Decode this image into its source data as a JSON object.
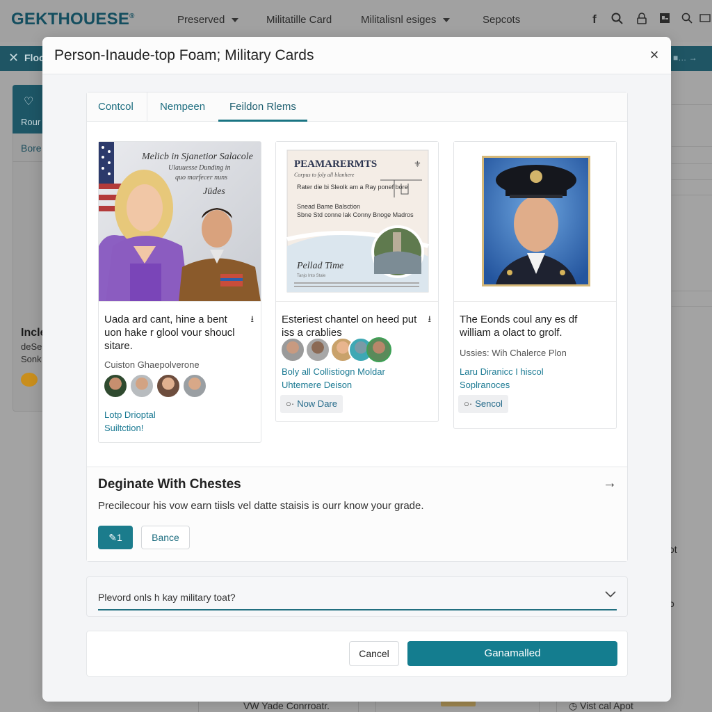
{
  "background": {
    "logo": "GEKTHOUESE",
    "nav": [
      {
        "label": "Preserved",
        "has_dropdown": true
      },
      {
        "label": "Militatille Card",
        "has_dropdown": false
      },
      {
        "label": "Militalisnl esiges",
        "has_dropdown": true
      },
      {
        "label": "Sepcots",
        "has_dropdown": false
      }
    ],
    "header_icons": [
      "facebook-icon",
      "search-icon",
      "lock-icon",
      "image-icon",
      "search-icon",
      "window-icon"
    ],
    "teal_bar_label": "Floo",
    "sidebar": {
      "top_label": "Rour",
      "item": "Bore",
      "heading": "Incle",
      "line1": "deSe",
      "line2": "Sonk"
    },
    "right_text_1": "ot",
    "right_text_2": "o",
    "bottom_items": [
      "VW Yade Conrroatr.",
      "Vist cal Apot"
    ]
  },
  "modal": {
    "title": "Person-Inaude-top Foam; Military Cards",
    "close_label": "×",
    "tabs": [
      {
        "label": "Contcol",
        "active": false
      },
      {
        "label": "Nempeen",
        "active": false
      },
      {
        "label": "Feildon Rlems",
        "active": true
      }
    ],
    "cards": [
      {
        "image_alt": "Woman in purple and soldier in uniform with flag",
        "image_caption": [
          "Melicb in Sjanetior Salacole",
          "Ulauuesse Dunding in",
          "quo marfecer nuns"
        ],
        "title": "Uada ard cant, hine a bent uon hake r glool vour shoucl sitare.",
        "subtitle": "Cuiston Ghaepolverone",
        "avatar_count": 4,
        "link": "Lotp Drioptal Suiltction!",
        "chip": null
      },
      {
        "image_alt": "Certificate document with castle image",
        "image_caption": [
          "PEAMARERMTS",
          "Rater die bi Sleolk am a Ray ponef bore",
          "Snead Bame Balsction",
          "Sbne Std conne lak Conny Bnoge Madros"
        ],
        "title": "Esteriest chantel on heed put iss a crablies",
        "subtitle": null,
        "avatar_count": 5,
        "link": "Boly all Collistiogn Moldar Uhtemere Deison",
        "chip": "Now Dare"
      },
      {
        "image_alt": "Portrait of soldier in dress uniform and cap",
        "image_caption": [],
        "title": "The Eonds coul any es df william a olact to grolf.",
        "subtitle": "Ussies: Wih Chalerce Plon",
        "avatar_count": 0,
        "link": "Laru Diranicc I hiscol Soplranoces",
        "chip": "Sencol"
      }
    ],
    "section": {
      "title": "Deginate With Chestes",
      "description": "Precilecour his vow earn tiisls vel datte staisis is ourr know your grade.",
      "primary_label": "1",
      "secondary_label": "Bance"
    },
    "select": {
      "value": "Plevord onls h kay military toat?"
    },
    "footer": {
      "cancel_label": "Cancel",
      "confirm_label": "Ganamalled"
    }
  },
  "colors": {
    "accent": "#147d8f",
    "link": "#1b7a93",
    "overlay": "#a3a3a3"
  }
}
